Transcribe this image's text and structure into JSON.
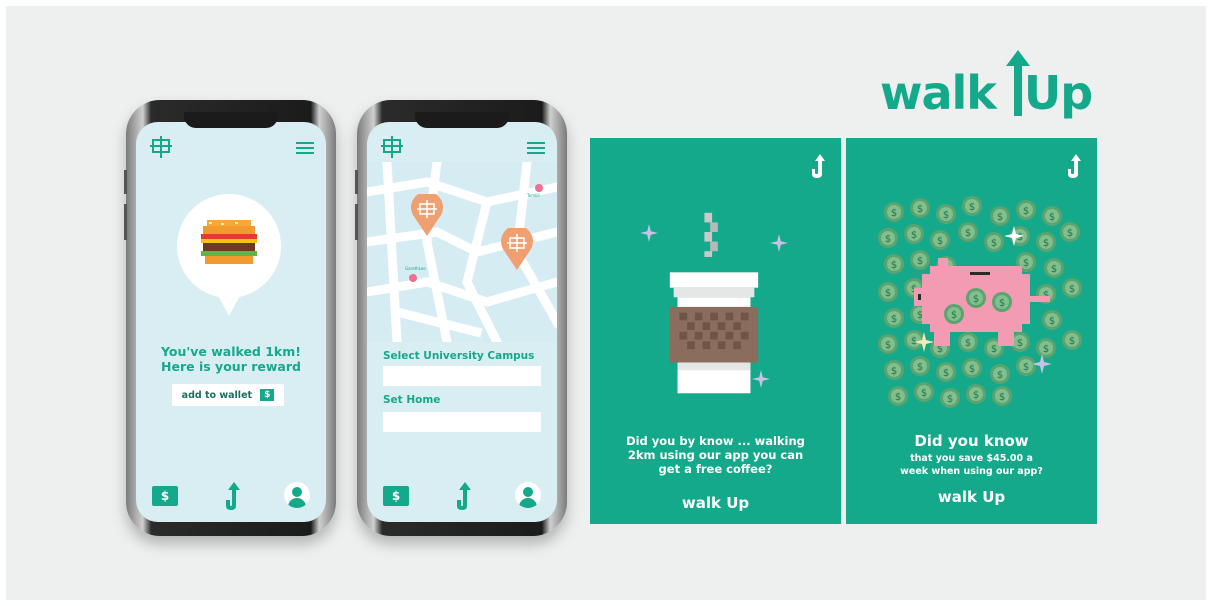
{
  "brand": {
    "wordmark_left": "walk",
    "wordmark_right": "Up",
    "color": "#14a98b"
  },
  "phone_reward": {
    "screen_title_line1": "You've walked 1km!",
    "screen_title_line2": "Here is your reward",
    "add_wallet_label": "add to wallet",
    "add_wallet_icon": "$",
    "nav_wallet_icon": "$",
    "icons": [
      "campus-logo-icon",
      "menu-icon",
      "wallet-icon",
      "walkup-arrow-icon",
      "profile-icon",
      "burger-icon"
    ]
  },
  "phone_map": {
    "map_label_1": "Tomlill",
    "map_label_2": "GarethLee",
    "campus_label": "Select University Campus",
    "home_label": "Set Home",
    "campus_value": "",
    "home_value": "",
    "nav_wallet_icon": "$",
    "icons": [
      "campus-logo-icon",
      "menu-icon",
      "map-pin-icon",
      "wallet-icon",
      "walkup-arrow-icon",
      "profile-icon"
    ]
  },
  "poster_coffee": {
    "text_line1": "Did you by know ... walking",
    "text_line2": "2km using our app you can",
    "text_line3": "get a free coffee?",
    "logo_left": "walk",
    "logo_right": "Up"
  },
  "poster_piggy": {
    "heading": "Did you know",
    "text_line1": "that you save $45.00 a",
    "text_line2": "week when using our app?",
    "coin_symbol": "$",
    "logo_left": "walk",
    "logo_right": "Up"
  },
  "colors": {
    "accent": "#14a98b",
    "screen_bg": "#d9eef3",
    "pin": "#f0a070",
    "coin": "#5ba36f",
    "pig": "#f29bb3",
    "sparkle": "#c7c2e6"
  }
}
